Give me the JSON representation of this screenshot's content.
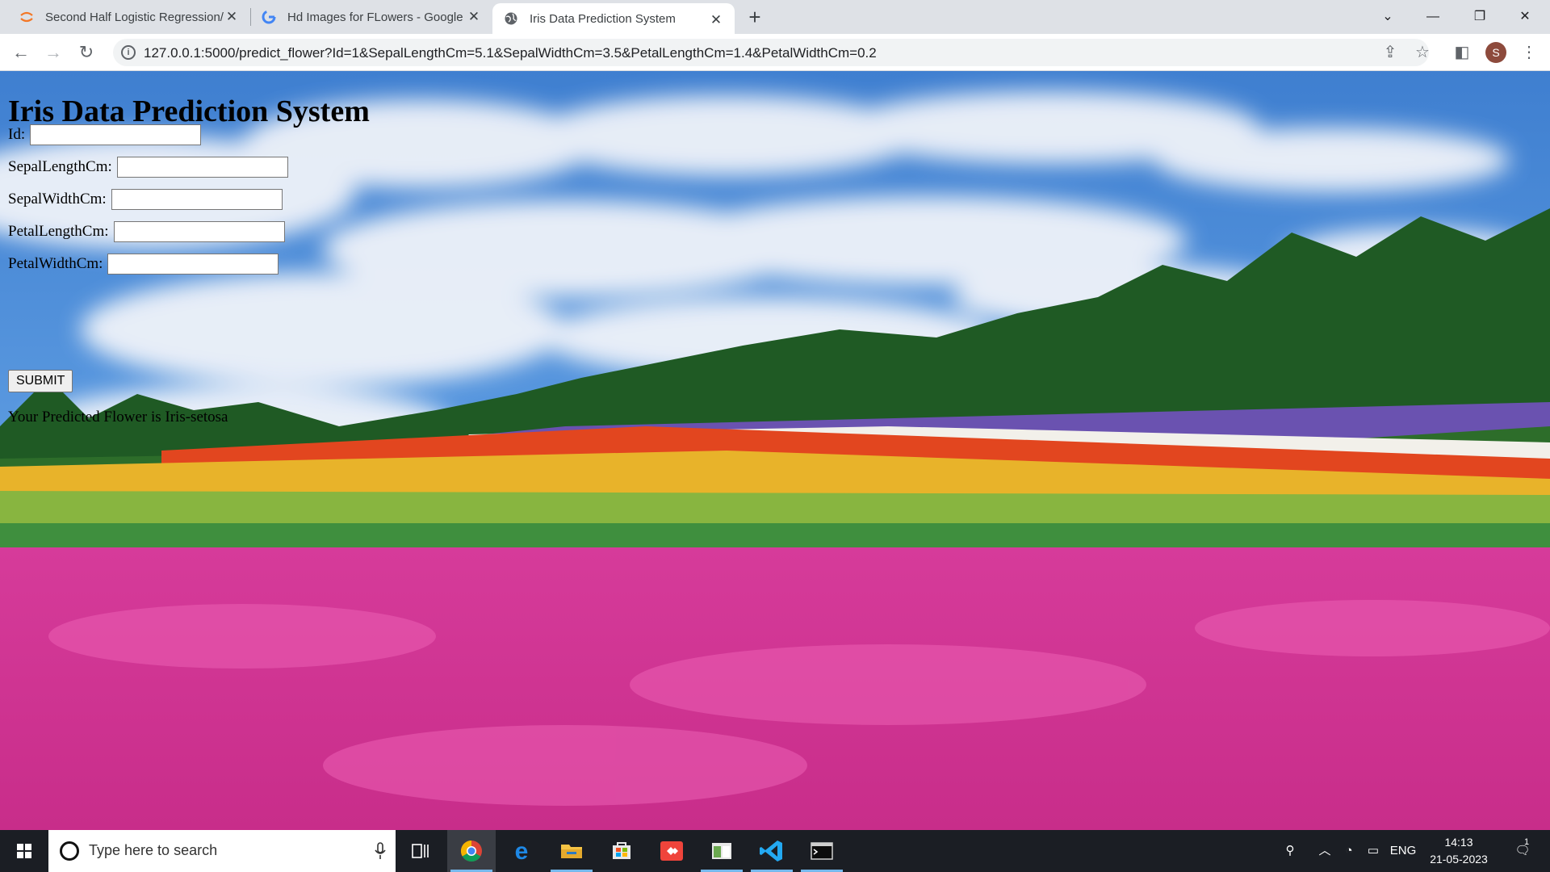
{
  "browser": {
    "tabs": [
      {
        "title": "Second Half Logistic Regression/",
        "icon": "jupyter-icon"
      },
      {
        "title": "Hd Images for FLowers - Google",
        "icon": "google-icon"
      },
      {
        "title": "Iris Data Prediction System",
        "icon": "globe-icon",
        "active": true
      }
    ],
    "new_tab_label": "+",
    "url": "127.0.0.1:5000/predict_flower?Id=1&SepalLengthCm=5.1&SepalWidthCm=3.5&PetalLengthCm=1.4&PetalWidthCm=0.2",
    "profile_initial": "S"
  },
  "page": {
    "title": "Iris Data Prediction System",
    "fields": [
      {
        "label": "Id:",
        "value": ""
      },
      {
        "label": "SepalLengthCm:",
        "value": ""
      },
      {
        "label": "SepalWidthCm:",
        "value": ""
      },
      {
        "label": "PetalLengthCm:",
        "value": ""
      },
      {
        "label": "PetalWidthCm:",
        "value": ""
      }
    ],
    "submit_label": "SUBMIT",
    "result_text": "Your Predicted Flower is Iris-setosa"
  },
  "taskbar": {
    "search_placeholder": "Type here to search",
    "language": "ENG",
    "time": "14:13",
    "date": "21-05-2023",
    "notification_count": "1"
  }
}
